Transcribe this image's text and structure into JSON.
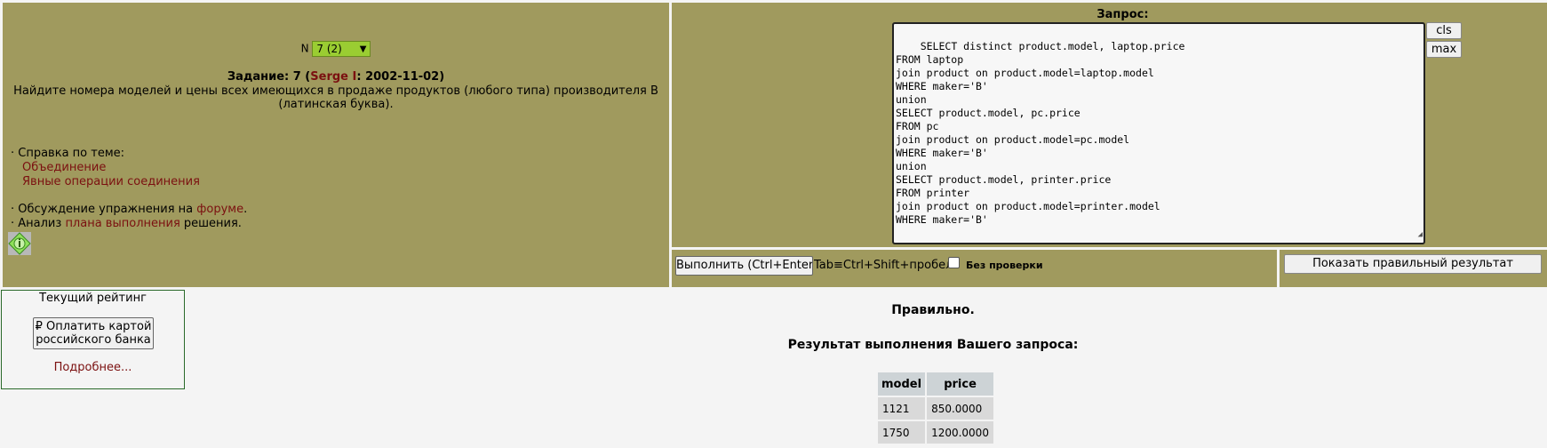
{
  "task": {
    "n_label": "N",
    "selected": "7 (2)",
    "title_prefix": "Задание: 7 (",
    "author": "Serge I",
    "title_suffix": ": 2002-11-02)",
    "description": "Найдите номера моделей и цены всех имеющихся в продаже продуктов (любого типа) производителя B (латинская буква)."
  },
  "help": {
    "label": "· Справка по теме:",
    "link1": "Объединение",
    "link2": "Явные операции соединения",
    "forum_prefix": "· Обсуждение упражнения на ",
    "forum_link": "форуме",
    "forum_suffix": ".",
    "plan_prefix": "· Анализ ",
    "plan_link": "плана выполнения",
    "plan_suffix": " решения."
  },
  "query": {
    "label": "Запрос:",
    "sql": "SELECT distinct product.model, laptop.price\nFROM laptop\njoin product on product.model=laptop.model\nWHERE maker='B'\nunion\nSELECT product.model, pc.price\nFROM pc\njoin product on product.model=pc.model\nWHERE maker='B'\nunion\nSELECT product.model, printer.price\nFROM printer\njoin product on product.model=printer.model\nWHERE maker='B'",
    "cls_label": "cls",
    "max_label": "max"
  },
  "run": {
    "run_label": "Выполнить (Ctrl+Enter)",
    "tab_hint": "Tab≡Ctrl+Shift+пробел",
    "nocheck_label": "Без  проверки",
    "show_label": "Показать правильный результат"
  },
  "rating": {
    "title": "Текущий рейтинг",
    "pay_label_1": "₽ Оплатить картой",
    "pay_label_2": "российского банка",
    "more": "Подробнее..."
  },
  "result": {
    "status": "Правильно.",
    "title": "Результат выполнения Вашего запроса:",
    "columns": [
      "model",
      "price"
    ],
    "rows": [
      [
        "1121",
        "850.0000"
      ],
      [
        "1750",
        "1200.0000"
      ]
    ]
  },
  "colors": {
    "panel": "#a09a5e",
    "link": "#7b1010",
    "select": "#9acd32"
  }
}
